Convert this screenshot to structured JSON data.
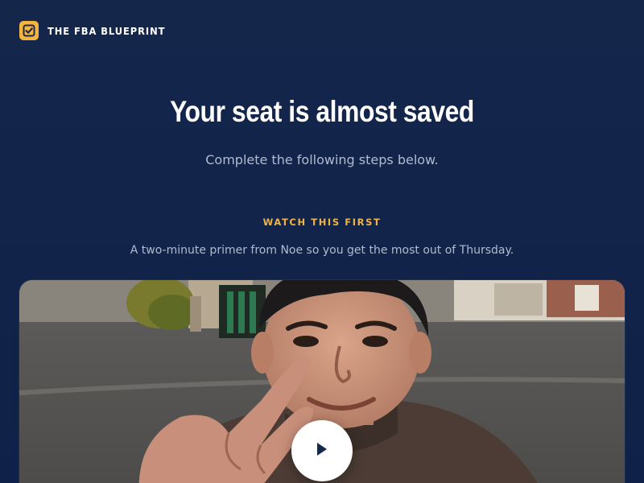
{
  "brand": {
    "name": "THE FBA BLUEPRINT",
    "icon": "checkbox-icon",
    "accent_color": "#f4b53f"
  },
  "hero": {
    "title": "Your seat is almost saved",
    "subtitle": "Complete the following steps below."
  },
  "video_section": {
    "eyebrow": "WATCH THIS FIRST",
    "description": "A two-minute primer from Noe so you get the most out of Thursday.",
    "play_icon": "play-icon"
  },
  "colors": {
    "background": "#12244a",
    "eyebrow": "#f2b441",
    "muted_text": "#aebbd1"
  }
}
